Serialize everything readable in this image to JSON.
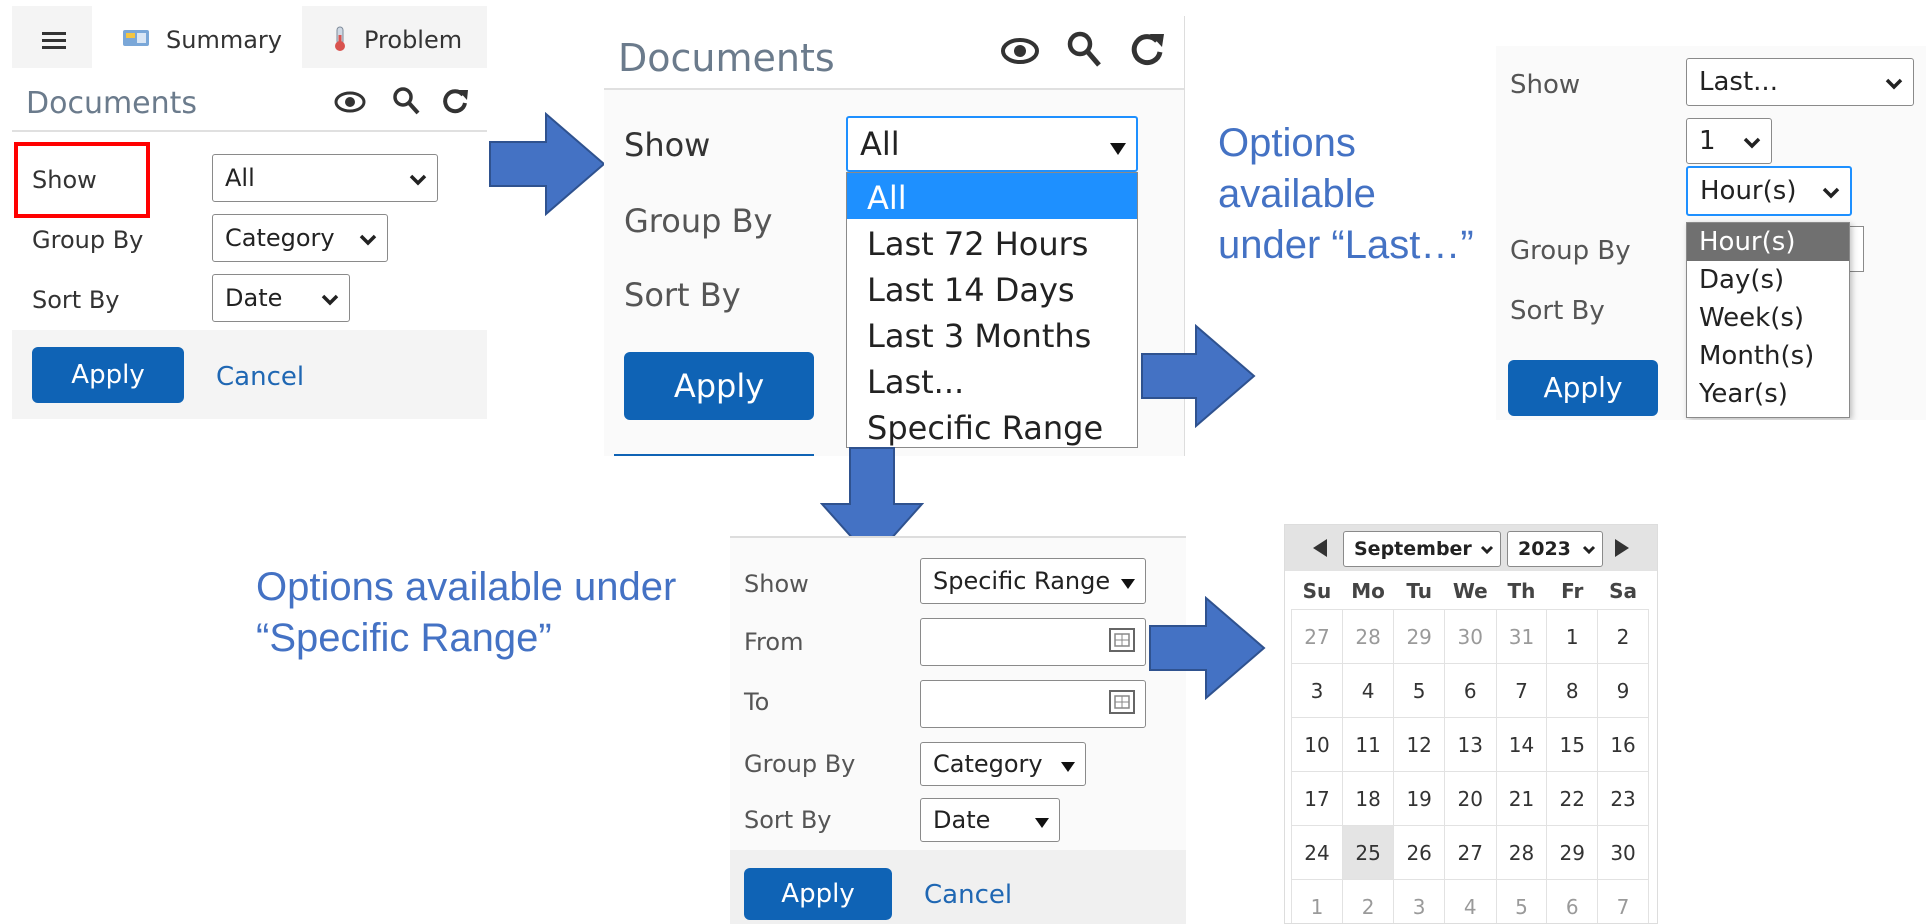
{
  "panel1": {
    "menu_icon": "hamburger-icon",
    "tabs": [
      {
        "label": "Summary",
        "icon": "summary-icon"
      },
      {
        "label": "Problem",
        "icon": "thermometer-icon"
      }
    ],
    "title": "Documents",
    "icons": [
      "eye-icon",
      "search-icon",
      "refresh-icon"
    ],
    "show_label": "Show",
    "show_value": "All",
    "group_label": "Group By",
    "group_value": "Category",
    "sort_label": "Sort By",
    "sort_value": "Date",
    "apply": "Apply",
    "cancel": "Cancel",
    "highlight_color": "#ff0000"
  },
  "panel2": {
    "title": "Documents",
    "show_label": "Show",
    "show_value": "All",
    "group_label": "Group By",
    "sort_label": "Sort By",
    "apply": "Apply",
    "options": [
      "All",
      "Last 72 Hours",
      "Last 14 Days",
      "Last 3 Months",
      "Last...",
      "Specific Range"
    ],
    "selected_color": "#1e90ff"
  },
  "note_last": [
    "Options",
    "available",
    "under “Last…”"
  ],
  "panel3": {
    "show_label": "Show",
    "show_value": "Last...",
    "count_value": "1",
    "unit_value": "Hour(s)",
    "group_label": "Group By",
    "sort_label": "Sort By",
    "apply": "Apply",
    "units": [
      "Hour(s)",
      "Day(s)",
      "Week(s)",
      "Month(s)",
      "Year(s)"
    ]
  },
  "note_range": [
    "Options available under",
    "“Specific Range”"
  ],
  "panel4": {
    "show_label": "Show",
    "show_value": "Specific Range",
    "from_label": "From",
    "to_label": "To",
    "group_label": "Group By",
    "group_value": "Category",
    "sort_label": "Sort By",
    "sort_value": "Date",
    "apply": "Apply",
    "cancel": "Cancel"
  },
  "calendar": {
    "month": "September",
    "year": "2023",
    "weekdays": [
      "Su",
      "Mo",
      "Tu",
      "We",
      "Th",
      "Fr",
      "Sa"
    ],
    "weeks": [
      [
        "27",
        "28",
        "29",
        "30",
        "31",
        "1",
        "2"
      ],
      [
        "3",
        "4",
        "5",
        "6",
        "7",
        "8",
        "9"
      ],
      [
        "10",
        "11",
        "12",
        "13",
        "14",
        "15",
        "16"
      ],
      [
        "17",
        "18",
        "19",
        "20",
        "21",
        "22",
        "23"
      ],
      [
        "24",
        "25",
        "26",
        "27",
        "28",
        "29",
        "30"
      ],
      [
        "1",
        "2",
        "3",
        "4",
        "5",
        "6",
        "7"
      ]
    ],
    "today": "25"
  },
  "colors": {
    "arrow": "#4472c4",
    "button": "#0f63b5",
    "link": "#1f67b3"
  }
}
